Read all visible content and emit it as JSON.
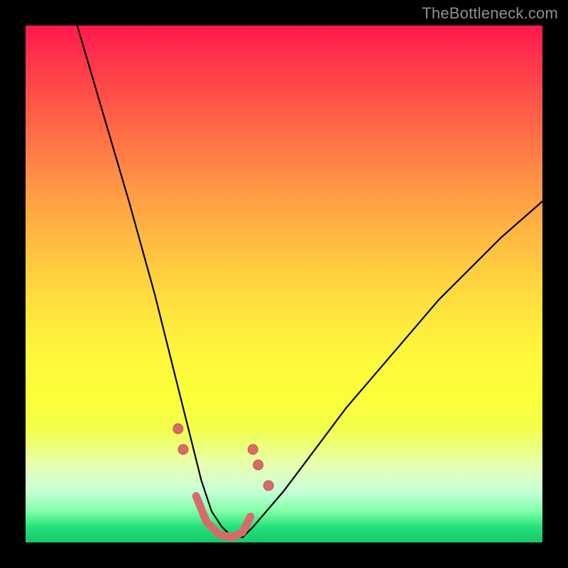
{
  "watermark": "TheBottleneck.com",
  "colors": {
    "frame": "#000000",
    "curve": "#000000",
    "markers": "#d96a6a",
    "gradient_top": "#ff1a4d",
    "gradient_bottom": "#15c96a"
  },
  "chart_data": {
    "type": "line",
    "title": "",
    "xlabel": "",
    "ylabel": "",
    "xlim": [
      0,
      100
    ],
    "ylim": [
      0,
      100
    ],
    "series": [
      {
        "name": "bottleneck-curve",
        "x": [
          10,
          15,
          20,
          25,
          28,
          30,
          32,
          34,
          36,
          38,
          40,
          42,
          44,
          50,
          56,
          62,
          68,
          74,
          80,
          86,
          92,
          100
        ],
        "values": [
          100,
          83,
          66,
          48,
          36,
          28,
          20,
          12,
          6,
          3,
          1,
          1,
          3,
          10,
          18,
          26,
          33,
          40,
          47,
          53,
          59,
          66
        ]
      }
    ],
    "markers": [
      {
        "x": 29.5,
        "y": 22
      },
      {
        "x": 30.5,
        "y": 18
      },
      {
        "x": 44.0,
        "y": 18
      },
      {
        "x": 45.0,
        "y": 15
      },
      {
        "x": 47.0,
        "y": 11
      }
    ],
    "marker_trough_path": [
      {
        "x": 33.0,
        "y": 9
      },
      {
        "x": 35.0,
        "y": 4
      },
      {
        "x": 37.5,
        "y": 1.5
      },
      {
        "x": 40.0,
        "y": 1
      },
      {
        "x": 42.0,
        "y": 2
      },
      {
        "x": 43.5,
        "y": 5
      }
    ]
  }
}
